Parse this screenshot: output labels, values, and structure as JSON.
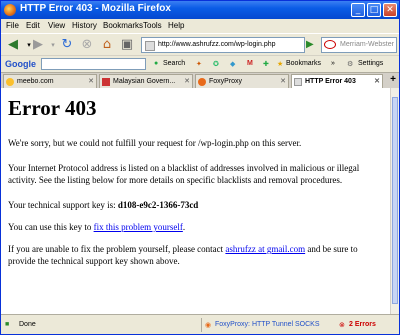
{
  "window": {
    "title": "HTTP Error 403 - Mozilla Firefox",
    "btn_min": "_",
    "btn_max": "□",
    "btn_close": "✕"
  },
  "menu": [
    "File",
    "Edit",
    "View",
    "History",
    "Bookmarks",
    "Tools",
    "Help"
  ],
  "navbar": {
    "url": "http://www.ashrufzz.com/wp-login.php",
    "search_placeholder": "Merriam-Webster"
  },
  "google_toolbar": {
    "logo": "Google",
    "search_label": "Search",
    "bookmarks_label": "Bookmarks",
    "more_label": "»",
    "settings_label": "Settings"
  },
  "tabs": [
    {
      "label": "meebo.com",
      "active": false
    },
    {
      "label": "Malaysian Govern...",
      "active": false
    },
    {
      "label": "FoxyProxy",
      "active": false
    },
    {
      "label": "HTTP Error 403",
      "active": true
    }
  ],
  "page": {
    "heading": "Error 403",
    "p1": "We're sorry, but we could not fulfill your request for /wp-login.php on this server.",
    "p2": "Your Internet Protocol address is listed on a blacklist of addresses involved in malicious or illegal activity. See the listing below for more details on specific blacklists and removal procedures.",
    "p3_prefix": "Your technical support key is:",
    "support_key": "d108-e9c2-1366-73cd",
    "p4_prefix": "You can use this key to",
    "p4_link": "fix this problem yourself",
    "p4_suffix": ".",
    "p5_prefix": "If you are unable to fix the problem yourself, please contact",
    "p5_link": "ashrufzz at gmail.com",
    "p5_suffix": "and be sure to provide the technical support key shown above."
  },
  "status": {
    "text": "Done",
    "proxy": "FoxyProxy: HTTP Tunnel SOCKS",
    "errors": "2 Errors"
  }
}
